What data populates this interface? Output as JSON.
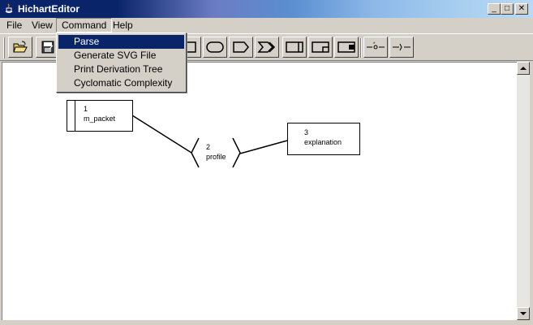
{
  "window": {
    "title": "HichartEditor",
    "min_glyph": "_",
    "max_glyph": "□",
    "close_glyph": "✕"
  },
  "menubar": {
    "file": "File",
    "view": "View",
    "command": "Command",
    "help": "Help"
  },
  "command_menu": {
    "items": [
      "Parse",
      "Generate SVG File",
      "Print Derivation Tree",
      "Cyclomatic Complexity"
    ],
    "selected_index": 0
  },
  "toolbar": {
    "tools": [
      "open-folder-icon",
      "save-icon",
      "rectangle-tool-icon",
      "rounded-tool-icon",
      "pentagon-tool-icon",
      "double-arrow-tool-icon",
      "bar-rect-tool-icon",
      "notch-rect-tool-icon",
      "tab-rect-tool-icon",
      "connector-dash-icon",
      "connector-branch-icon"
    ]
  },
  "diagram": {
    "nodes": [
      {
        "number": "1",
        "name": "m_packet"
      },
      {
        "number": "2",
        "name": "profile"
      },
      {
        "number": "3",
        "name": "explanation"
      }
    ]
  },
  "colors": {
    "selection": "#0a246a",
    "face": "#d4d0c8",
    "canvas": "#ffffff"
  }
}
